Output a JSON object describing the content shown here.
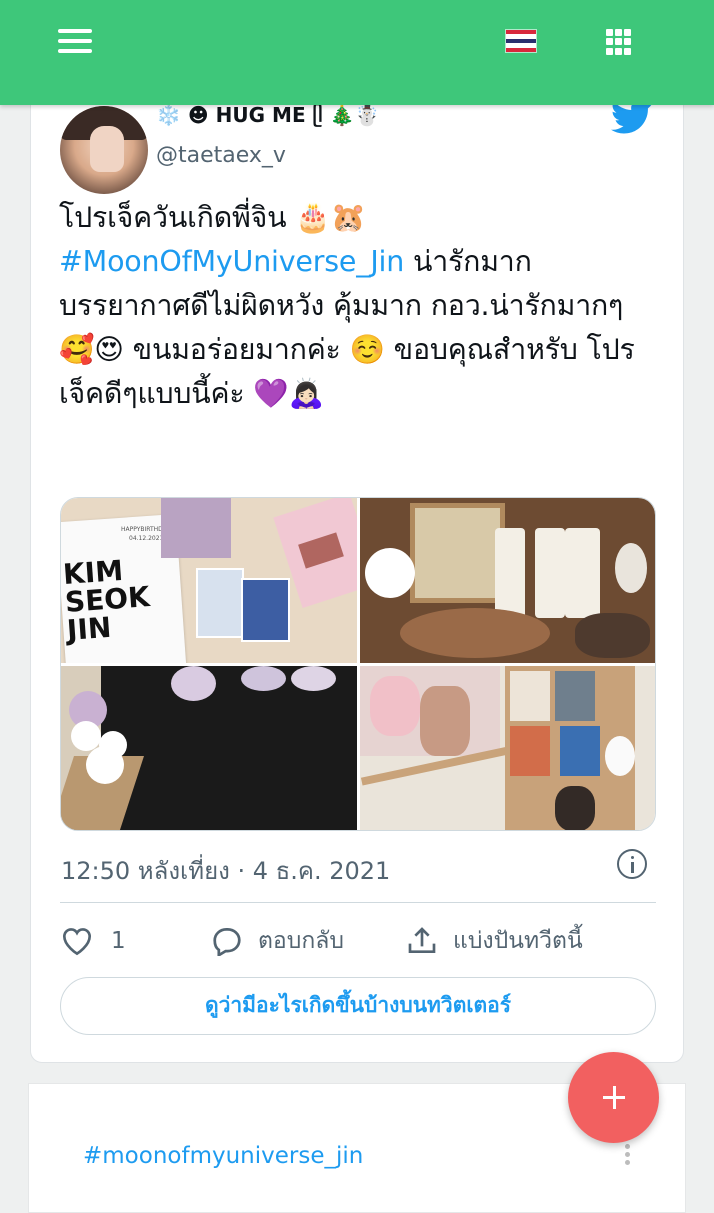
{
  "topbar": {
    "menu_icon": "hamburger-menu-icon",
    "language_flag": "thailand-flag-icon",
    "apps_icon": "grid-apps-icon",
    "color": "#3ec77a"
  },
  "tweet": {
    "display_name": "❄️ ☻ HUG ME ᥫ 🎄☃️",
    "handle": "@taetaex_v",
    "text_line1": "โปรเจ็ควันเกิดพี่จิน 🎂🐹",
    "hashtag": "#MoonOfMyUniverse_Jin",
    "text_after_hashtag": " น่ารักมาก",
    "text_rest": "บรรยากาศดีไม่ผิดหวัง คุ้มมาก กอว.น่ารักมากๆ 🥰😍 ขนมอร่อยมากค่ะ ☺️ ขอบคุณสำหรับ โปรเจ็คดีๆแบบนี้ค่ะ 💜🙇🏻‍♀️",
    "photo1_text": "KIM\nSEOK\nJIN",
    "photo1_small": "HAPPYBIRTHDAY",
    "photo1_date": "04.12.2021",
    "timestamp": "12:50 หลังเที่ยง · 4 ธ.ค. 2021",
    "likes_count": "1",
    "reply_label": "ตอบกลับ",
    "share_label": "แบ่งปันทวีตนี้",
    "see_more_label": "ดูว่ามีอะไรเกิดขึ้นบ้างบนทวิตเตอร์",
    "accent_color": "#1d9bf0"
  },
  "next_card": {
    "hashtag": "#moonofmyuniverse_jin"
  },
  "fab": {
    "icon": "plus-icon",
    "color": "#f26060"
  }
}
